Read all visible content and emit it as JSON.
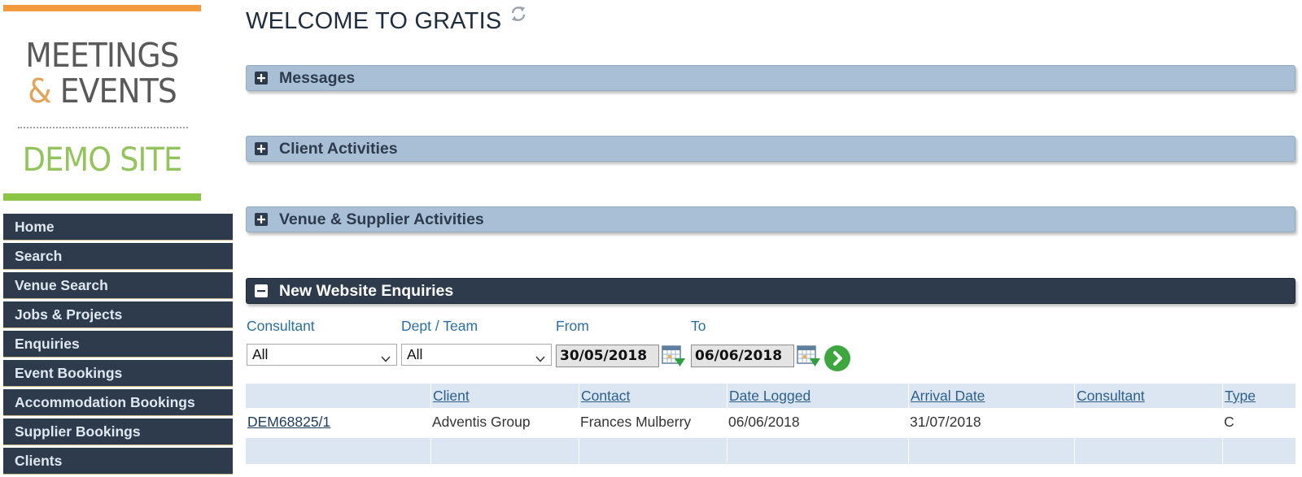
{
  "logo": {
    "line1": "MEETINGS",
    "amp": "&",
    "line2": "EVENTS",
    "line3": "DEMO SITE"
  },
  "nav": {
    "items": [
      "Home",
      "Search",
      "Venue Search",
      "Jobs & Projects",
      "Enquiries",
      "Event Bookings",
      "Accommodation Bookings",
      "Supplier Bookings",
      "Clients"
    ]
  },
  "page": {
    "title": "WELCOME TO GRATIS",
    "refresh_icon": "refresh-icon"
  },
  "panels": {
    "messages": "Messages",
    "client_activities": "Client Activities",
    "venue_supplier": "Venue & Supplier Activities",
    "website_enquiries": "New Website Enquiries"
  },
  "filters": {
    "consultant_label": "Consultant",
    "consultant_value": "All",
    "dept_label": "Dept / Team",
    "dept_value": "All",
    "from_label": "From",
    "from_value": "30/05/2018",
    "to_label": "To",
    "to_value": "06/06/2018"
  },
  "table": {
    "headers": [
      "Client",
      "Contact",
      "Date Logged",
      "Arrival Date",
      "Consultant",
      "Type"
    ],
    "rows": [
      {
        "ref": "DEM68825/1",
        "client": "Adventis Group",
        "contact": "Frances Mulberry",
        "date_logged": "06/06/2018",
        "arrival_date": "31/07/2018",
        "consultant": "",
        "type": "C"
      }
    ]
  },
  "colors": {
    "nav_bg": "#2d3b4c",
    "panel_bg": "#a8bfd6",
    "accent_orange": "#f39a3e",
    "accent_green": "#8cc446",
    "label_blue": "#2c6e9e"
  }
}
